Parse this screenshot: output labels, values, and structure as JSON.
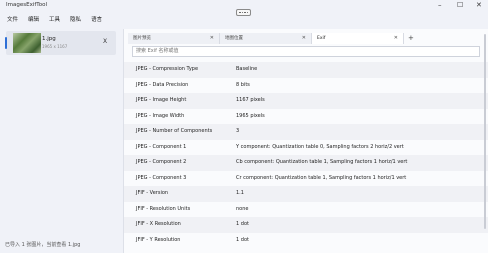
{
  "window": {
    "title": "ImagesExifTool",
    "controls": {
      "minimize": "–",
      "maximize": "☐",
      "close": "✕"
    }
  },
  "menu": [
    "文件",
    "编辑",
    "工具",
    "隐私",
    "语言"
  ],
  "sidebar": {
    "file": {
      "name": "1.jpg",
      "size": "1965 x 1167",
      "close": "X"
    }
  },
  "status": "已导入 1 张图片，当前查看 1.jpg",
  "tabs": [
    {
      "label": "图片预览",
      "close": "✕"
    },
    {
      "label": "地图位置",
      "close": "✕"
    },
    {
      "label": "Exif",
      "close": "✕"
    }
  ],
  "tab_add": "+",
  "search": {
    "placeholder": "搜索 Exif 名称或值"
  },
  "exif": [
    {
      "key": "JPEG - Compression Type",
      "value": "Baseline"
    },
    {
      "key": "JPEG - Data Precision",
      "value": "8 bits"
    },
    {
      "key": "JPEG - Image Height",
      "value": "1167 pixels"
    },
    {
      "key": "JPEG - Image Width",
      "value": "1965 pixels"
    },
    {
      "key": "JPEG - Number of Components",
      "value": "3"
    },
    {
      "key": "JPEG - Component 1",
      "value": "Y component: Quantization table 0, Sampling factors 2 horiz/2 vert"
    },
    {
      "key": "JPEG - Component 2",
      "value": "Cb component: Quantization table 1, Sampling factors 1 horiz/1 vert"
    },
    {
      "key": "JPEG - Component 3",
      "value": "Cr component: Quantization table 1, Sampling factors 1 horiz/1 vert"
    },
    {
      "key": "JFIF - Version",
      "value": "1.1"
    },
    {
      "key": "JFIF - Resolution Units",
      "value": "none"
    },
    {
      "key": "JFIF - X Resolution",
      "value": "1 dot"
    },
    {
      "key": "JFIF - Y Resolution",
      "value": "1 dot"
    }
  ]
}
